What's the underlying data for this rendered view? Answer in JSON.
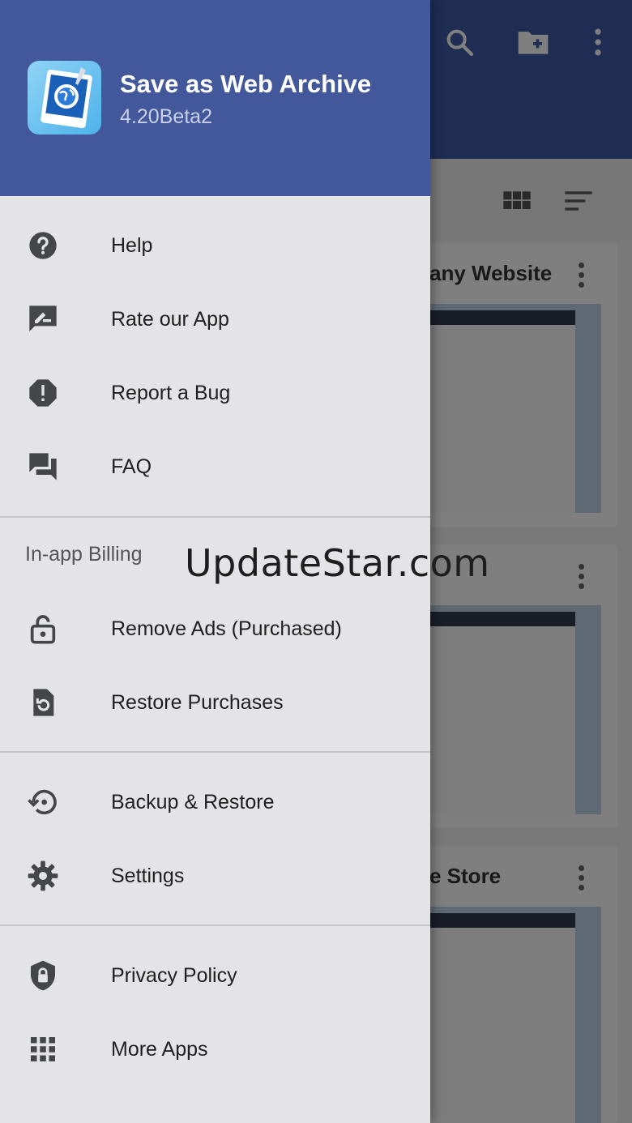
{
  "drawer": {
    "app_name": "Save as Web Archive",
    "app_version": "4.20Beta2",
    "icon_color": "#45464a",
    "header_color": "#42589a",
    "items_top": [
      {
        "label": "Help",
        "icon": "help-circle-icon"
      },
      {
        "label": "Rate our App",
        "icon": "rate-review-icon"
      },
      {
        "label": "Report a Bug",
        "icon": "report-bug-icon"
      },
      {
        "label": "FAQ",
        "icon": "forum-icon"
      }
    ],
    "billing_header": "In-app Billing",
    "items_billing": [
      {
        "label": "Remove Ads (Purchased)",
        "icon": "lock-open-icon"
      },
      {
        "label": "Restore Purchases",
        "icon": "restore-page-icon"
      }
    ],
    "items_settings": [
      {
        "label": "Backup & Restore",
        "icon": "backup-restore-icon"
      },
      {
        "label": "Settings",
        "icon": "gear-icon"
      }
    ],
    "items_more": [
      {
        "label": "Privacy Policy",
        "icon": "shield-icon"
      },
      {
        "label": "More Apps",
        "icon": "apps-grid-icon"
      }
    ]
  },
  "background": {
    "toolbar_icons": [
      "search-icon",
      "new-folder-icon",
      "more-vert-icon"
    ],
    "cards": [
      {
        "title": "any Website"
      },
      {
        "title": ""
      },
      {
        "title": "e Store"
      }
    ]
  },
  "watermark": "UpdateStar.com"
}
